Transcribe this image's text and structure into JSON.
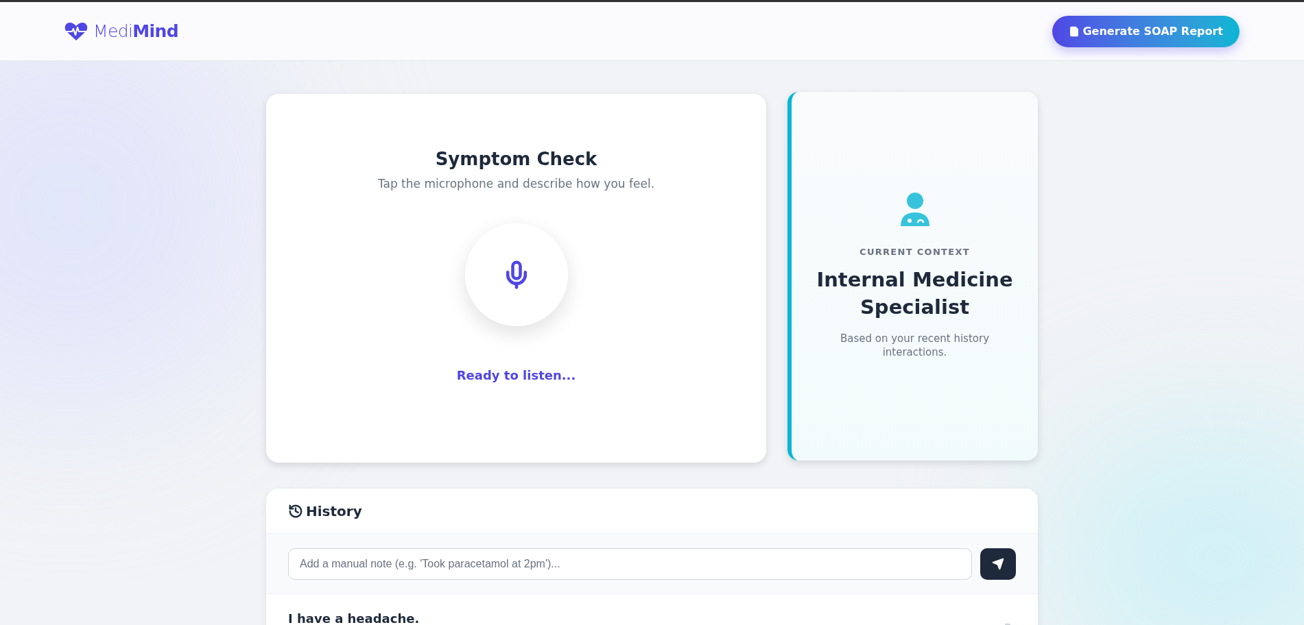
{
  "header": {
    "logo_light": "Medi",
    "logo_bold": "Mind",
    "report_button": "Generate SOAP Report"
  },
  "symptom_check": {
    "title": "Symptom Check",
    "subtitle": "Tap the microphone and describe how you feel.",
    "status": "Ready to listen..."
  },
  "context": {
    "label": "CURRENT CONTEXT",
    "specialist": "Internal Medicine Specialist",
    "note": "Based on your recent history interactions."
  },
  "history": {
    "title": "History",
    "note_field": {
      "placeholder": "Add a manual note (e.g. 'Took paracetamol at 2pm')..."
    },
    "entries": [
      {
        "text": "I have a headache."
      }
    ]
  }
}
